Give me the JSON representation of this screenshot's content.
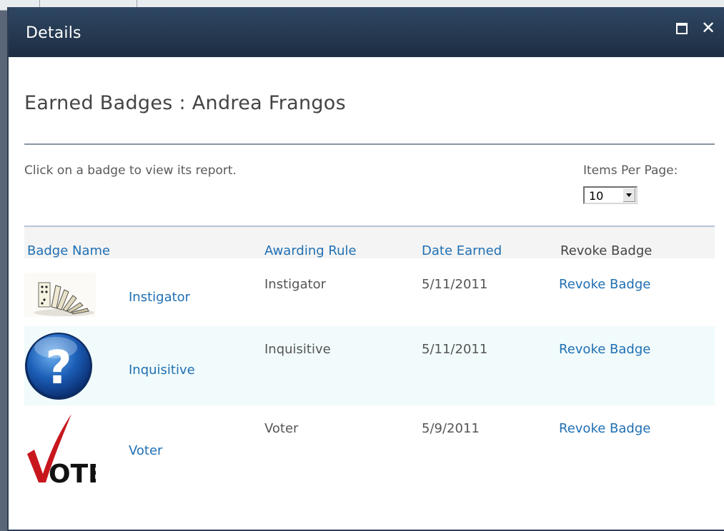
{
  "dialog": {
    "title": "Details",
    "heading": "Earned Badges : Andrea Frangos",
    "instructions": "Click on a badge to view its report.",
    "items_per_page_label": "Items Per Page:",
    "items_per_page_value": "10"
  },
  "table": {
    "headers": [
      "Badge Name",
      "Awarding Rule",
      "Date Earned",
      "Revoke Badge"
    ],
    "rows": [
      {
        "name": "Instigator",
        "rule": "Instigator",
        "date": "5/11/2011",
        "action": "Revoke Badge",
        "icon": "dominoes-icon"
      },
      {
        "name": "Inquisitive",
        "rule": "Inquisitive",
        "date": "5/11/2011",
        "action": "Revoke Badge",
        "icon": "question-mark-icon"
      },
      {
        "name": "Voter",
        "rule": "Voter",
        "date": "5/9/2011",
        "action": "Revoke Badge",
        "icon": "vote-checkmark-icon"
      }
    ]
  },
  "badge_images": {
    "vote_text": "OTE"
  },
  "colors": {
    "titlebar": "#243850",
    "link": "#1f6fb3",
    "alt_row": "#f1fbfb"
  }
}
